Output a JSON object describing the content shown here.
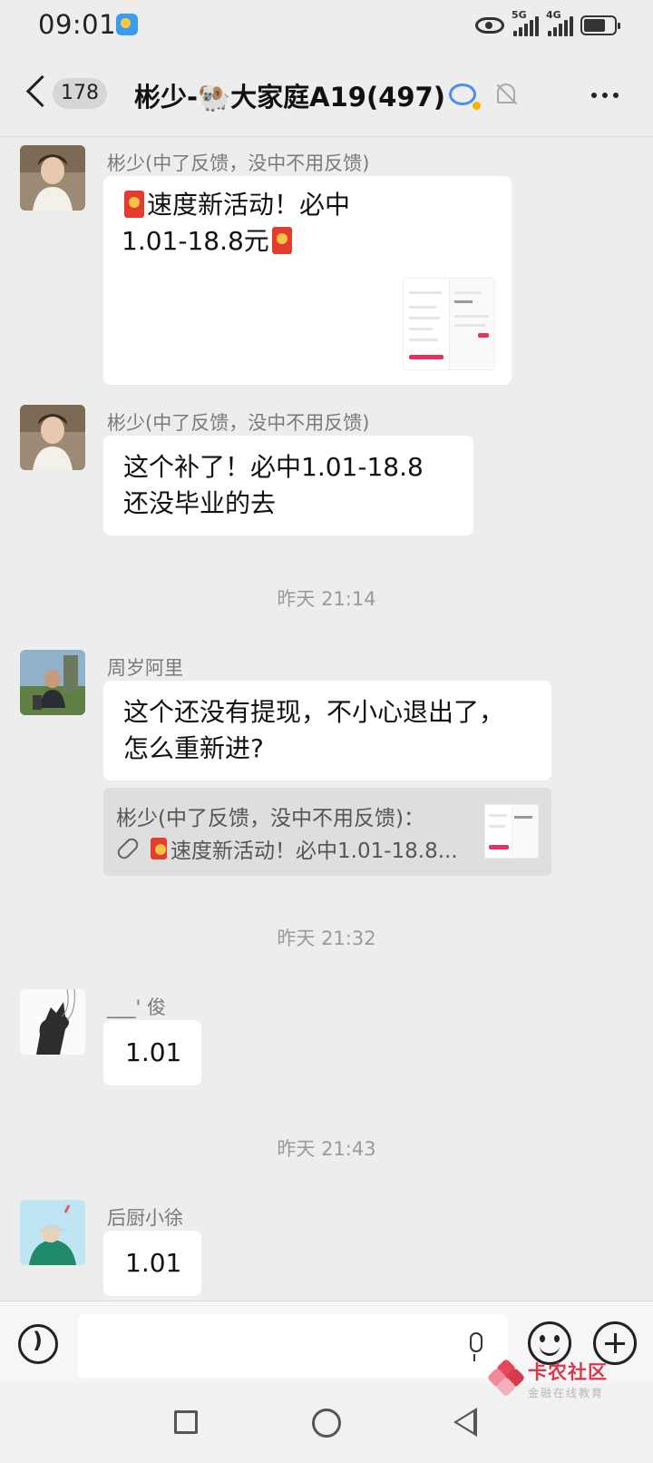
{
  "status_bar": {
    "time": "09:01",
    "network1": "5G",
    "network2": "4G"
  },
  "header": {
    "unread_count": "178",
    "title": "彬少-🐏大家庭A19(497)"
  },
  "messages": [
    {
      "sender": "彬少(中了反馈，没中不用反馈)",
      "line1": "速度新活动！必中",
      "line2": "1.01-18.8元"
    },
    {
      "sender": "彬少(中了反馈，没中不用反馈)",
      "line1": "这个补了！必中1.01-18.8",
      "line2": "还没毕业的去"
    },
    {
      "timestamp": "昨天 21:14"
    },
    {
      "sender": "周岁阿里",
      "line1": "这个还没有提现，不小心退出了，",
      "line2": "怎么重新进?",
      "quote": {
        "line1": "彬少(中了反馈，没中不用反馈)：",
        "line2": "速度新活动！必中1.01-18.8..."
      }
    },
    {
      "timestamp": "昨天 21:32"
    },
    {
      "sender": "___' 俊",
      "text": "1.01"
    },
    {
      "timestamp": "昨天 21:43"
    },
    {
      "sender": "后厨小徐",
      "text": "1.01"
    }
  ],
  "watermark": {
    "title": "卡农社区",
    "subtitle": "金融在线教育"
  },
  "colors": {
    "background": "#ededed",
    "bubble": "#ffffff",
    "red_packet": "#e53c2f",
    "accent_blue": "#4a8ff0"
  },
  "icons": [
    "back-icon",
    "group-chat-icon",
    "mute-bell-icon",
    "more-icon",
    "voice-icon",
    "mic-icon",
    "emoji-icon",
    "plus-icon",
    "link-icon",
    "red-packet-icon"
  ]
}
